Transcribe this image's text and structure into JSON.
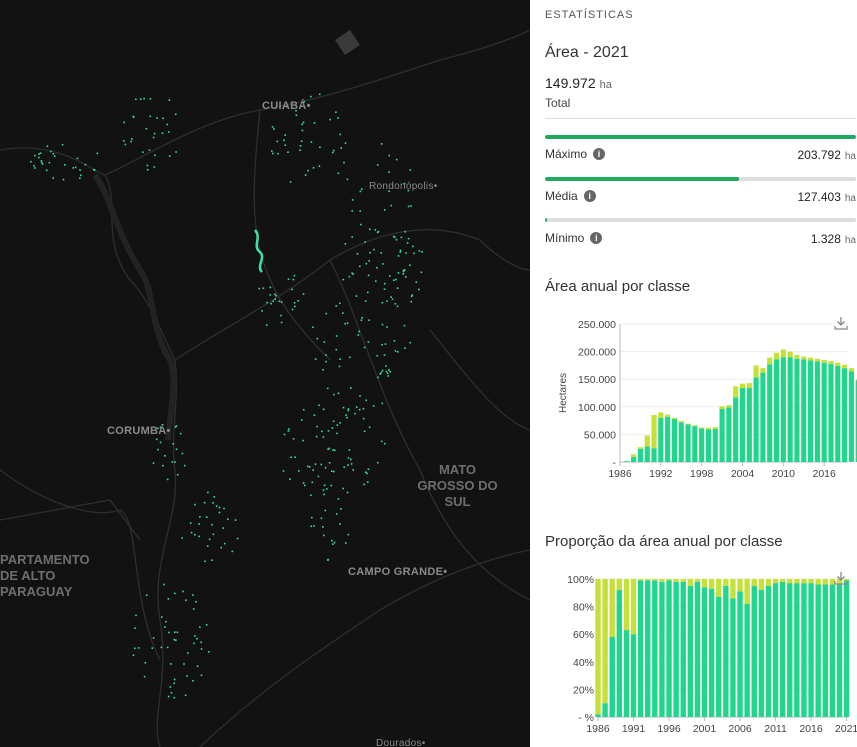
{
  "map": {
    "cities": [
      {
        "label": "CUIABÁ•"
      },
      {
        "label": "Rondonópolis•"
      },
      {
        "label": "CORUMBÁ•"
      },
      {
        "label": "CAMPO GRANDE•"
      },
      {
        "label": "Dourados•"
      }
    ],
    "regions": [
      {
        "label": "MATO\nGROSSO DO\nSUL"
      },
      {
        "label": "PARTAMENTO\nDE ALTO\nPARAGUAY"
      }
    ]
  },
  "panel": {
    "section_title": "ESTATÍSTICAS",
    "area_title": "Área - 2021",
    "total_value": "149.972",
    "total_unit": "ha",
    "total_label": "Total",
    "stats": [
      {
        "label": "Máximo",
        "value": "203.792",
        "unit": "ha",
        "fill_fraction": 1.0
      },
      {
        "label": "Média",
        "value": "127.403",
        "unit": "ha",
        "fill_fraction": 0.625
      },
      {
        "label": "Mínimo",
        "value": "1.328",
        "unit": "ha",
        "fill_fraction": 0.0065
      }
    ],
    "chart1_title": "Área anual por classe",
    "chart2_title": "Proporção da área anual por classe",
    "colors": {
      "green": "#1fa85e",
      "primary_class": "#20d68c",
      "secondary_class": "#c6e03a",
      "accent_dots": "#35e0a0"
    }
  },
  "chart_data": [
    {
      "type": "bar",
      "title": "Área anual por classe",
      "ylabel": "Hectares",
      "ylim": [
        0,
        250000
      ],
      "ytick_labels": [
        "250.000",
        "200.000",
        "150.000",
        "100.000",
        "50.000",
        "-"
      ],
      "xtick_labels": [
        "1986",
        "1992",
        "1998",
        "2004",
        "2010",
        "2016"
      ],
      "x": [
        1987,
        1988,
        1989,
        1990,
        1991,
        1992,
        1993,
        1994,
        1995,
        1996,
        1997,
        1998,
        1999,
        2000,
        2001,
        2002,
        2003,
        2004,
        2005,
        2006,
        2007,
        2008,
        2009,
        2010,
        2011,
        2012,
        2013,
        2014,
        2015,
        2016,
        2017,
        2018,
        2019,
        2020,
        2021
      ],
      "series": [
        {
          "values": [
            1500,
            9000,
            24000,
            28000,
            25000,
            80000,
            82000,
            78000,
            72000,
            68000,
            65000,
            61000,
            59000,
            60000,
            96000,
            99000,
            117000,
            134000,
            134000,
            153000,
            162000,
            177000,
            186000,
            190000,
            190000,
            187000,
            186000,
            184000,
            182000,
            180000,
            178000,
            174000,
            170000,
            164000,
            148000
          ]
        },
        {
          "values": [
            0,
            5000,
            3000,
            20000,
            60000,
            10000,
            4000,
            2000,
            2000,
            1500,
            1500,
            1500,
            3000,
            3000,
            5000,
            4000,
            20000,
            8000,
            9000,
            22000,
            8000,
            12000,
            12000,
            14000,
            10000,
            7000,
            5000,
            5000,
            5000,
            5000,
            5000,
            6000,
            6000,
            6000,
            2000
          ]
        }
      ]
    },
    {
      "type": "bar",
      "title": "Proporção da área anual por classe",
      "ylim": [
        0,
        100
      ],
      "ytick_labels": [
        "100%",
        "80%",
        "60%",
        "40%",
        "20%",
        "- %"
      ],
      "xtick_labels": [
        "1986",
        "1991",
        "1996",
        "2001",
        "2006",
        "2011",
        "2016",
        "2021"
      ],
      "x": [
        1986,
        1987,
        1988,
        1989,
        1990,
        1991,
        1992,
        1993,
        1994,
        1995,
        1996,
        1997,
        1998,
        1999,
        2000,
        2001,
        2002,
        2003,
        2004,
        2005,
        2006,
        2007,
        2008,
        2009,
        2010,
        2011,
        2012,
        2013,
        2014,
        2015,
        2016,
        2017,
        2018,
        2019,
        2020,
        2021
      ],
      "series": [
        {
          "values": [
            2,
            10,
            58,
            92,
            63,
            60,
            99,
            99,
            99,
            98,
            99,
            98,
            98,
            95,
            98,
            94,
            93,
            87,
            95,
            86,
            91,
            82,
            95,
            92,
            95,
            97,
            98,
            97,
            97,
            97,
            97,
            96,
            96,
            96,
            96,
            99
          ]
        },
        {
          "values": [
            98,
            90,
            42,
            8,
            37,
            40,
            1,
            1,
            1,
            2,
            1,
            2,
            2,
            5,
            2,
            6,
            7,
            13,
            5,
            14,
            9,
            18,
            5,
            8,
            5,
            3,
            2,
            3,
            3,
            3,
            3,
            4,
            4,
            4,
            4,
            1
          ]
        }
      ]
    }
  ]
}
